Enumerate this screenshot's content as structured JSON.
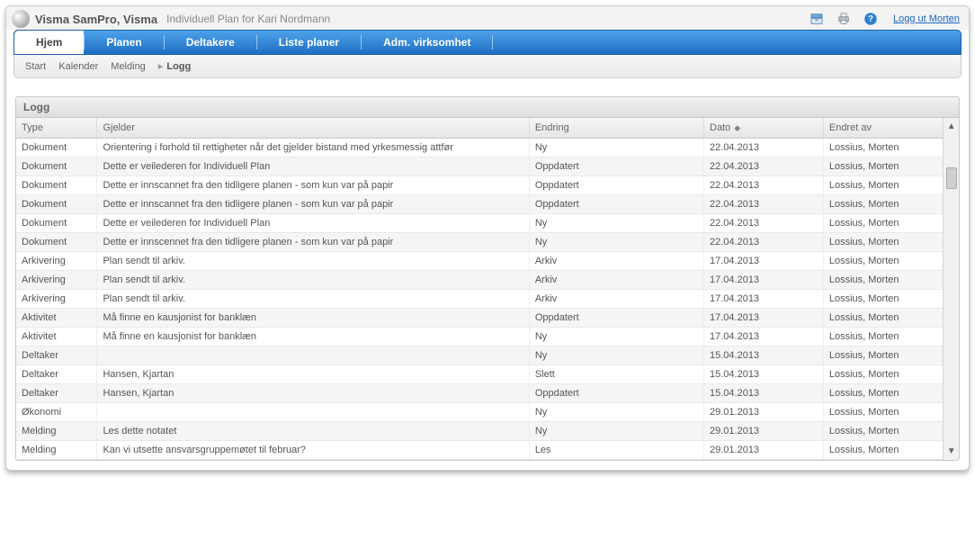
{
  "header": {
    "app_name": "Visma SamPro, Visma",
    "subtitle": "Individuell Plan for Kari Nordmann",
    "logout_label": "Logg ut Morten"
  },
  "nav": {
    "tabs": [
      "Hjem",
      "Planen",
      "Deltakere",
      "Liste planer",
      "Adm. virksomhet"
    ],
    "active_index": 0
  },
  "breadcrumb": {
    "items": [
      "Start",
      "Kalender",
      "Melding"
    ],
    "current": "Logg"
  },
  "panel": {
    "title": "Logg"
  },
  "table": {
    "columns": {
      "type": "Type",
      "gjelder": "Gjelder",
      "endring": "Endring",
      "dato": "Dato",
      "endret_av": "Endret av"
    },
    "sort_column": "dato",
    "rows": [
      {
        "type": "Dokument",
        "gjelder": "Orientering i forhold til rettigheter når det gjelder bistand med yrkesmessig attfør",
        "endring": "Ny",
        "dato": "22.04.2013",
        "endret_av": "Lossius, Morten"
      },
      {
        "type": "Dokument",
        "gjelder": "Dette er veilederen for Individuell Plan",
        "endring": "Oppdatert",
        "dato": "22.04.2013",
        "endret_av": "Lossius, Morten"
      },
      {
        "type": "Dokument",
        "gjelder": "Dette er innscannet fra den tidligere planen - som kun var på papir",
        "endring": "Oppdatert",
        "dato": "22.04.2013",
        "endret_av": "Lossius, Morten"
      },
      {
        "type": "Dokument",
        "gjelder": "Dette er innscannet fra den tidligere planen - som kun var på papir",
        "endring": "Oppdatert",
        "dato": "22.04.2013",
        "endret_av": "Lossius, Morten"
      },
      {
        "type": "Dokument",
        "gjelder": "Dette er veilederen for Individuell Plan",
        "endring": "Ny",
        "dato": "22.04.2013",
        "endret_av": "Lossius, Morten"
      },
      {
        "type": "Dokument",
        "gjelder": "Dette er innscennet fra den tidligere planen - som kun var på papir",
        "endring": "Ny",
        "dato": "22.04.2013",
        "endret_av": "Lossius, Morten"
      },
      {
        "type": "Arkivering",
        "gjelder": "Plan sendt til arkiv.",
        "endring": "Arkiv",
        "dato": "17.04.2013",
        "endret_av": "Lossius, Morten"
      },
      {
        "type": "Arkivering",
        "gjelder": "Plan sendt til arkiv.",
        "endring": "Arkiv",
        "dato": "17.04.2013",
        "endret_av": "Lossius, Morten"
      },
      {
        "type": "Arkivering",
        "gjelder": "Plan sendt til arkiv.",
        "endring": "Arkiv",
        "dato": "17.04.2013",
        "endret_av": "Lossius, Morten"
      },
      {
        "type": "Aktivitet",
        "gjelder": "Må finne en kausjonist for banklæn",
        "endring": "Oppdatert",
        "dato": "17.04.2013",
        "endret_av": "Lossius, Morten"
      },
      {
        "type": "Aktivitet",
        "gjelder": "Må finne en kausjonist for banklæn",
        "endring": "Ny",
        "dato": "17.04.2013",
        "endret_av": "Lossius, Morten"
      },
      {
        "type": "Deltaker",
        "gjelder": "",
        "endring": "Ny",
        "dato": "15.04.2013",
        "endret_av": "Lossius, Morten"
      },
      {
        "type": "Deltaker",
        "gjelder": "Hansen, Kjartan",
        "endring": "Slett",
        "dato": "15.04.2013",
        "endret_av": "Lossius, Morten"
      },
      {
        "type": "Deltaker",
        "gjelder": "Hansen, Kjartan",
        "endring": "Oppdatert",
        "dato": "15.04.2013",
        "endret_av": "Lossius, Morten"
      },
      {
        "type": "Økonomi",
        "gjelder": "",
        "endring": "Ny",
        "dato": "29.01.2013",
        "endret_av": "Lossius, Morten"
      },
      {
        "type": "Melding",
        "gjelder": "Les dette notatet",
        "endring": "Ny",
        "dato": "29.01.2013",
        "endret_av": "Lossius, Morten"
      },
      {
        "type": "Melding",
        "gjelder": "Kan vi utsette ansvarsgruppemøtet til februar?",
        "endring": "Les",
        "dato": "29.01.2013",
        "endret_av": "Lossius, Morten"
      }
    ]
  }
}
